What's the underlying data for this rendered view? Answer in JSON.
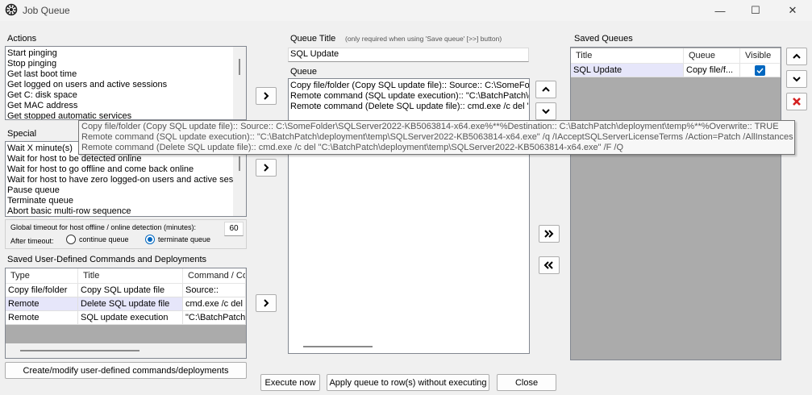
{
  "window": {
    "title": "Job Queue",
    "minimize_glyph": "—",
    "maximize_glyph": "☐",
    "close_glyph": "✕"
  },
  "actions": {
    "label": "Actions",
    "items": [
      "Start pinging",
      "Stop pinging",
      "Get last boot time",
      "Get logged on users and active sessions",
      "Get C: disk space",
      "Get MAC address",
      "Get stopped automatic services"
    ]
  },
  "special": {
    "label": "Special",
    "items": [
      "Wait X minute(s)",
      "Wait for host to be detected online",
      "Wait for host to go offline and come back online",
      "Wait for host to have zero logged-on users and active sess",
      "Pause queue",
      "Terminate queue",
      "Abort basic multi-row sequence"
    ]
  },
  "timeout": {
    "label": "Global timeout for host offline / online detection (minutes):",
    "value": "60",
    "after_label": "After timeout:",
    "option_continue": "continue queue",
    "option_terminate": "terminate queue",
    "selected": "terminate"
  },
  "saved_commands": {
    "label": "Saved User-Defined Commands and Deployments",
    "columns": [
      "Type",
      "Title",
      "Command / Co"
    ],
    "rows": [
      {
        "type": "Copy file/folder",
        "title": "Copy SQL update file",
        "command": "Source::"
      },
      {
        "type": "Remote",
        "title": "Delete SQL update file",
        "command": "cmd.exe /c del"
      },
      {
        "type": "Remote",
        "title": "SQL update execution",
        "command": "\"C:\\BatchPatch"
      }
    ],
    "create_button": "Create/modify user-defined commands/deployments"
  },
  "queue_title": {
    "label": "Queue Title",
    "hint": "(only required when using 'Save queue' [>>] button)",
    "value": "SQL Update"
  },
  "queue": {
    "label": "Queue",
    "items": [
      "Copy file/folder (Copy SQL update file):: Source:: C:\\SomeFold",
      "Remote command (SQL update execution):: \"C:\\BatchPatch\\c",
      "Remote command (Delete SQL update file):: cmd.exe /c del \"C"
    ]
  },
  "tooltip": {
    "lines": [
      "Copy file/folder (Copy SQL update file):: Source:: C:\\SomeFolder\\SQLServer2022-KB5063814-x64.exe%**%Destination:: C:\\BatchPatch\\deployment\\temp%**%Overwrite:: TRUE",
      "Remote command (SQL update execution):: \"C:\\BatchPatch\\deployment\\temp\\SQLServer2022-KB5063814-x64.exe\" /q /IAcceptSQLServerLicenseTerms /Action=Patch /AllInstances",
      "Remote command (Delete SQL update file):: cmd.exe /c del \"C:\\BatchPatch\\deployment\\temp\\SQLServer2022-KB5063814-x64.exe\" /F /Q"
    ]
  },
  "saved_queues": {
    "label": "Saved Queues",
    "columns": [
      "Title",
      "Queue",
      "Visible"
    ],
    "rows": [
      {
        "title": "SQL Update",
        "queue": "Copy file/f...",
        "visible": true
      }
    ]
  },
  "buttons": {
    "execute_now": "Execute now",
    "apply_queue": "Apply queue to row(s) without executing",
    "close": "Close"
  },
  "colors": {
    "accent": "#0067c0",
    "delete_red": "#d42020",
    "selection": "#e6e6fa"
  }
}
